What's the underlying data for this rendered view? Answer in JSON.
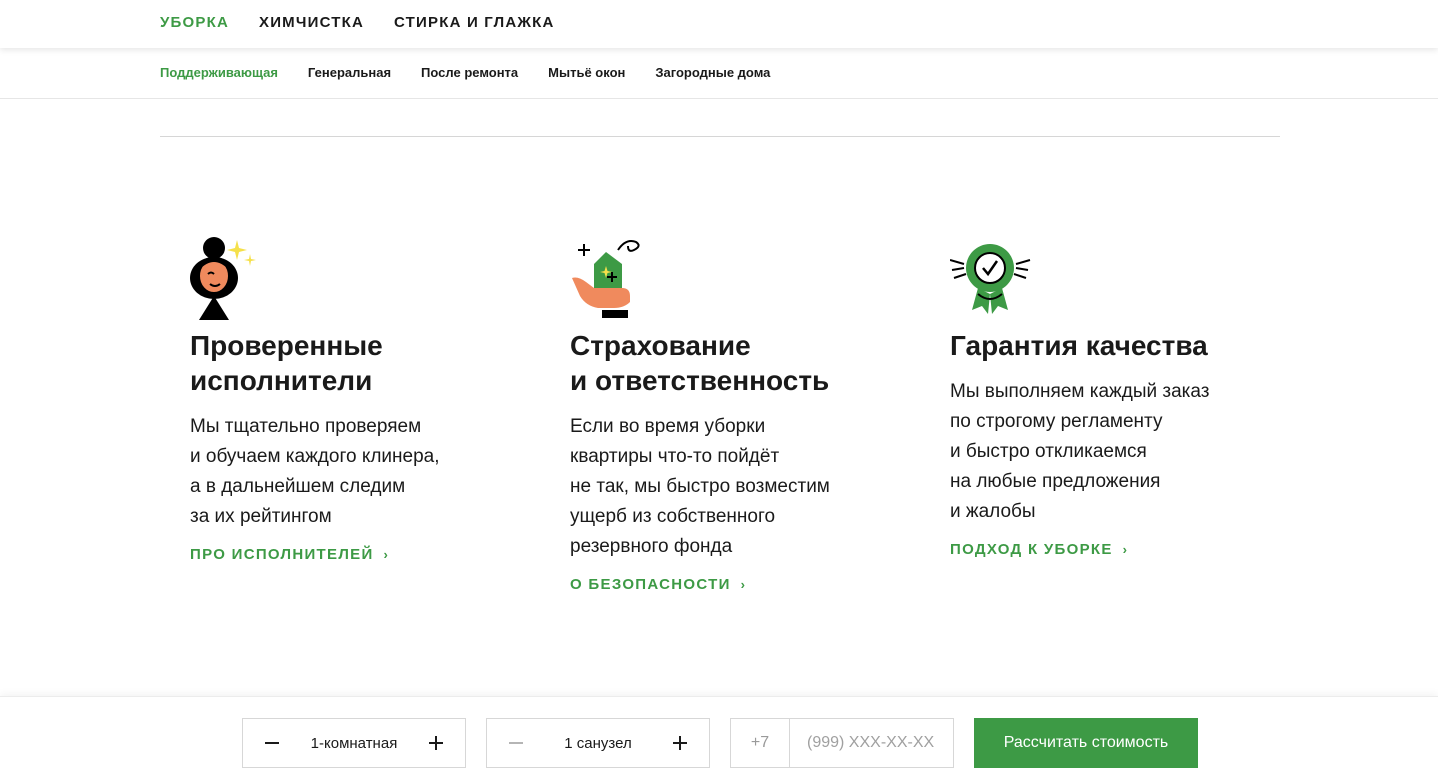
{
  "topnav": {
    "items": [
      {
        "label": "УБОРКА",
        "active": true
      },
      {
        "label": "ХИМЧИСТКА",
        "active": false
      },
      {
        "label": "СТИРКА И ГЛАЖКА",
        "active": false
      }
    ]
  },
  "subnav": {
    "items": [
      {
        "label": "Поддерживающая",
        "active": true
      },
      {
        "label": "Генеральная",
        "active": false
      },
      {
        "label": "После ремонта",
        "active": false
      },
      {
        "label": "Мытьё окон",
        "active": false
      },
      {
        "label": "Загородные дома",
        "active": false
      }
    ]
  },
  "features": [
    {
      "icon": "cleaner-woman-icon",
      "title": "Проверенные\nисполнители",
      "text": "Мы тщательно проверяем\nи обучаем каждого клинера,\nа в дальнейшем следим\nза их рейтингом",
      "link": "ПРО ИСПОЛНИТЕЛЕЙ"
    },
    {
      "icon": "insurance-hand-house-icon",
      "title": "Страхование\nи ответственность",
      "text": "Если во время уборки\nквартиры что-то пойдёт\nне так, мы быстро возместим\nущерб из собственного\nрезервного фонда",
      "link": "О БЕЗОПАСНОСТИ"
    },
    {
      "icon": "quality-badge-icon",
      "title": "Гарантия качества",
      "text": "Мы выполняем каждый заказ\nпо строгому регламенту\nи быстро откликаемся\nна любые предложения\nи жалобы",
      "link": "ПОДХОД К УБОРКЕ"
    }
  ],
  "bottombar": {
    "rooms": "1-комнатная",
    "bathrooms": "1 санузел",
    "phone_prefix": "+7",
    "phone_placeholder": "(999) XXX-XX-XX",
    "cta": "Рассчитать стоимость"
  },
  "colors": {
    "accent": "#3d9a45",
    "text": "#1a1a1a",
    "skin": "#f08a5d",
    "sparkle": "#f5e04a"
  }
}
